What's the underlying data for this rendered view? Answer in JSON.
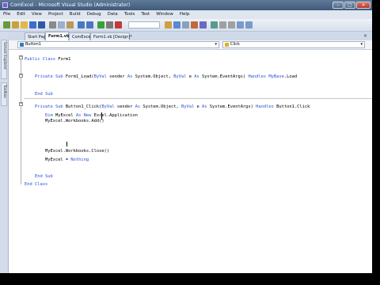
{
  "window": {
    "title": "ComExcel - Microsoft Visual Studio (Administrator)"
  },
  "menu": [
    "File",
    "Edit",
    "View",
    "Project",
    "Build",
    "Debug",
    "Data",
    "Tools",
    "Test",
    "Window",
    "Help"
  ],
  "tabs": [
    {
      "label": "Start Page",
      "active": false
    },
    {
      "label": "Form1.vb*",
      "active": true
    },
    {
      "label": "ComExcel",
      "active": false
    },
    {
      "label": "Form1.vb [Design]*",
      "active": false
    }
  ],
  "side_tabs": [
    "Server Explorer",
    "Toolbox"
  ],
  "nav": {
    "object": "Button1",
    "event": "Click"
  },
  "code_lines": [
    [
      {
        "t": "Public Class",
        "c": "kw"
      },
      {
        "t": " Form1"
      }
    ],
    [
      {
        "t": ""
      }
    ],
    [
      {
        "t": "    Private Sub",
        "c": "kw"
      },
      {
        "t": " Form1_Load("
      },
      {
        "t": "ByVal",
        "c": "kw"
      },
      {
        "t": " sender "
      },
      {
        "t": "As",
        "c": "kw"
      },
      {
        "t": " System.Object, "
      },
      {
        "t": "ByVal",
        "c": "kw"
      },
      {
        "t": " e "
      },
      {
        "t": "As",
        "c": "kw"
      },
      {
        "t": " System.EventArgs) "
      },
      {
        "t": "Handles",
        "c": "kw"
      },
      {
        "t": " "
      },
      {
        "t": "MyBase",
        "c": "kw"
      },
      {
        "t": ".Load"
      }
    ],
    [
      {
        "t": ""
      }
    ],
    [
      {
        "t": "    End Sub",
        "c": "kw"
      }
    ],
    [
      {
        "t": ""
      }
    ],
    [
      {
        "t": "    Private Sub",
        "c": "kw"
      },
      {
        "t": " Button1_Click("
      },
      {
        "t": "ByVal",
        "c": "kw"
      },
      {
        "t": " sender "
      },
      {
        "t": "As",
        "c": "kw"
      },
      {
        "t": " System.Object, "
      },
      {
        "t": "ByVal",
        "c": "kw"
      },
      {
        "t": " e "
      },
      {
        "t": "As",
        "c": "kw"
      },
      {
        "t": " System.EventArgs) "
      },
      {
        "t": "Handles",
        "c": "kw"
      },
      {
        "t": " Button1.Click"
      }
    ],
    [
      {
        "t": "        Dim",
        "c": "kw"
      },
      {
        "t": " MyExcel "
      },
      {
        "t": "As New",
        "c": "kw"
      },
      {
        "t": " Excel.Application"
      }
    ],
    [
      {
        "t": "        MyExcel.Workbooks.Add()"
      }
    ],
    [
      {
        "t": ""
      }
    ],
    [
      {
        "t": ""
      }
    ],
    [
      {
        "t": ""
      }
    ],
    [
      {
        "t": "        MyExcel.Workbooks.Close()"
      }
    ],
    [
      {
        "t": "        MyExcel = "
      },
      {
        "t": "Nothing",
        "c": "kw"
      }
    ],
    [
      {
        "t": ""
      }
    ],
    [
      {
        "t": "    End Sub",
        "c": "kw"
      }
    ],
    [
      {
        "t": "End Class",
        "c": "kw"
      }
    ]
  ]
}
